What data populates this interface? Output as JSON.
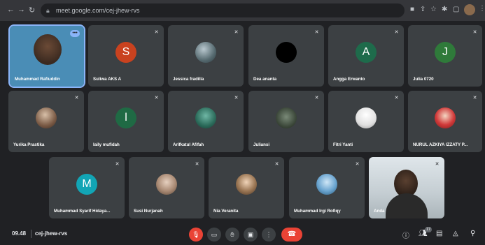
{
  "browser": {
    "url": "meet.google.com/cej-jhew-rvs"
  },
  "tiles": [
    {
      "name": "Muhammad Rafiuddin",
      "type": "video"
    },
    {
      "name": "Suliwa AKS A",
      "type": "letter",
      "letter": "S",
      "color": "#c9421f"
    },
    {
      "name": "Jessica fradilla",
      "type": "photo"
    },
    {
      "name": "Dea ananta",
      "type": "photo-dark"
    },
    {
      "name": "Angga Erwanto",
      "type": "letter",
      "letter": "A",
      "color": "#1e6b4b"
    },
    {
      "name": "Julia 0720",
      "type": "letter",
      "letter": "J",
      "color": "#2f7a3a"
    },
    {
      "name": "Yurika Prastika",
      "type": "photo"
    },
    {
      "name": "laily mufidah",
      "type": "letter",
      "letter": "l",
      "color": "#1f6a44"
    },
    {
      "name": "Arifkatul Afifah",
      "type": "photo"
    },
    {
      "name": "Juliansi",
      "type": "photo"
    },
    {
      "name": "Fitri Yanti",
      "type": "photo-light"
    },
    {
      "name": "NURUL AZKIYA IZZATY P...",
      "type": "photo-red"
    },
    {
      "name": "Muhammad Syarif Hidaya...",
      "type": "letter",
      "letter": "M",
      "color": "#12a5b5"
    },
    {
      "name": "Susi Nurjanah",
      "type": "photo"
    },
    {
      "name": "Nia Veranita",
      "type": "photo"
    },
    {
      "name": "Muhammad Irgi Rofiqy",
      "type": "photo-sky"
    },
    {
      "name": "Anda",
      "type": "video-self"
    }
  ],
  "bottom": {
    "time": "09.48",
    "code": "cej-jhew-rvs",
    "participants_count": "17"
  },
  "icons": {
    "back": "arrow-left-icon",
    "forward": "arrow-right-icon",
    "reload": "reload-icon",
    "mic": "mic-off-icon"
  }
}
